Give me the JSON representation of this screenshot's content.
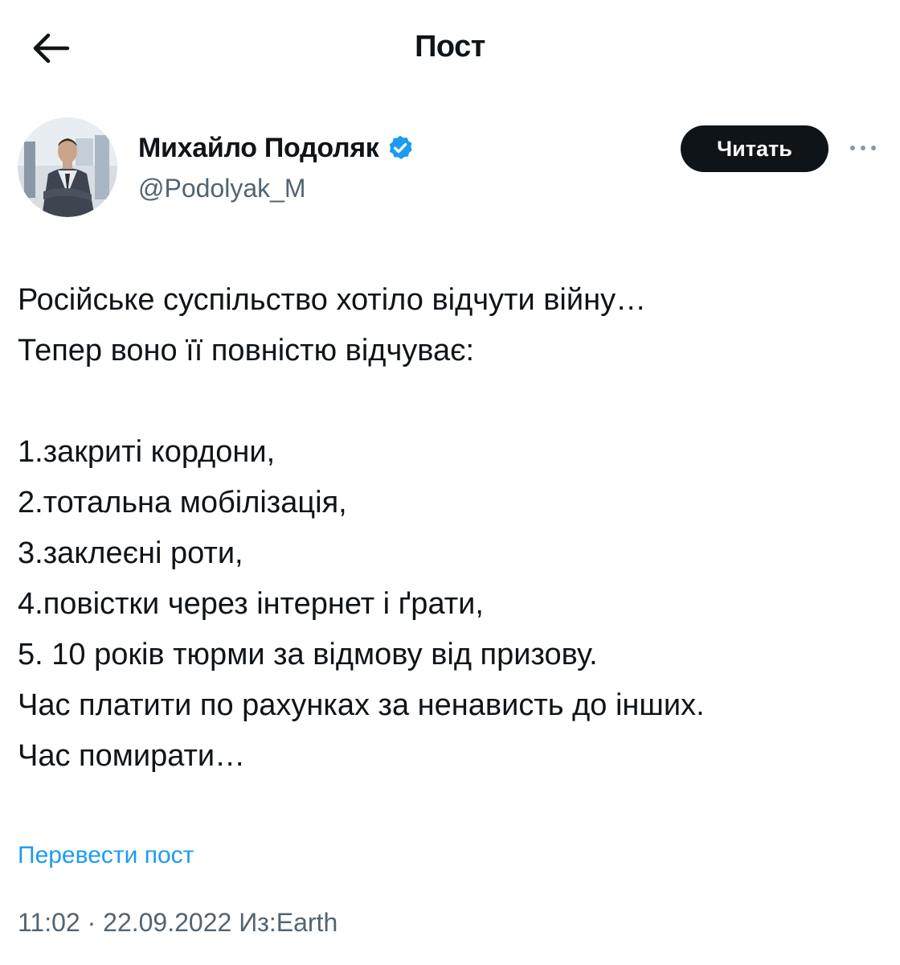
{
  "header": {
    "title": "Пост",
    "back_icon": "arrow-left-icon"
  },
  "author": {
    "name": "Михайло Подоляк",
    "handle": "@Podolyak_M",
    "verified": true,
    "verified_icon": "verified-badge-icon",
    "follow_label": "Читать",
    "more_icon": "more-horizontal-icon"
  },
  "post": {
    "lines": [
      "Російське суспільство хотіло відчути війну…",
      "Тепер воно її повністю відчуває:",
      "",
      "1.закриті кордони,",
      "2.тотальна мобілізація,",
      "3.заклеєні роти,",
      "4.повістки через інтернет і ґрати,",
      "5. 10 років тюрми за відмову від призову.",
      "Час платити по рахунках за ненависть до інших.",
      "Час помирати…"
    ],
    "translate_label": "Перевести пост",
    "time": "11:02",
    "separator": "·",
    "date": "22.09.2022",
    "source": "Из:Earth"
  },
  "colors": {
    "text": "#0f1419",
    "secondary": "#536471",
    "link": "#1d9bf0",
    "button_bg": "#0f1419",
    "verified": "#1d9bf0"
  }
}
